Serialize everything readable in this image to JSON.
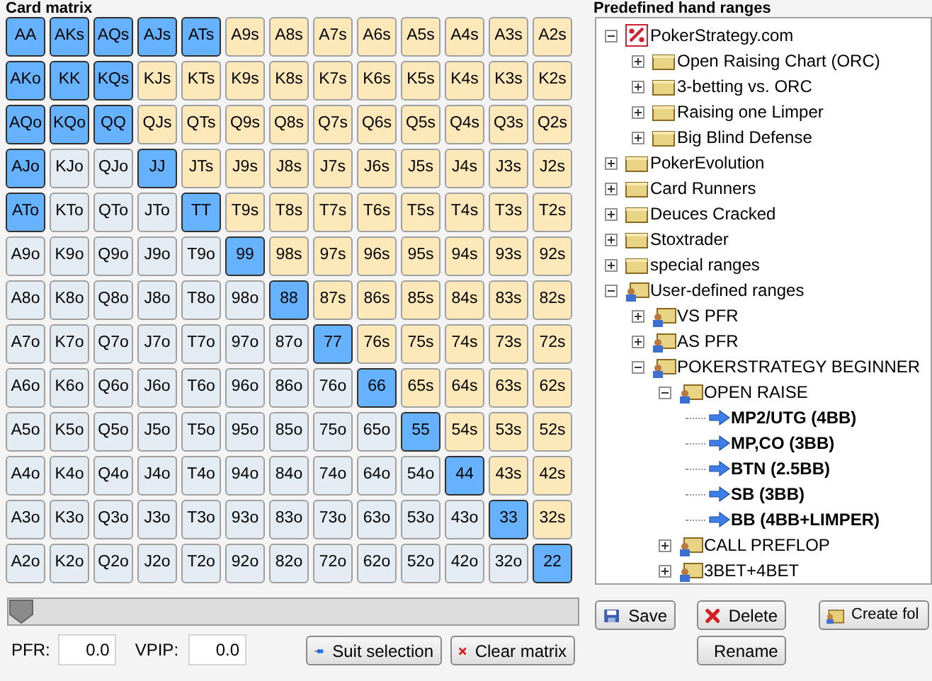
{
  "matrix": {
    "title": "Card matrix",
    "rows": [
      [
        {
          "label": "AA",
          "selected": true
        },
        {
          "label": "AKs",
          "selected": true
        },
        {
          "label": "AQs",
          "selected": true
        },
        {
          "label": "AJs",
          "selected": true
        },
        {
          "label": "ATs",
          "selected": true
        },
        {
          "label": "A9s",
          "selected": false
        },
        {
          "label": "A8s",
          "selected": false
        },
        {
          "label": "A7s",
          "selected": false
        },
        {
          "label": "A6s",
          "selected": false
        },
        {
          "label": "A5s",
          "selected": false
        },
        {
          "label": "A4s",
          "selected": false
        },
        {
          "label": "A3s",
          "selected": false
        },
        {
          "label": "A2s",
          "selected": false
        }
      ],
      [
        {
          "label": "AKo",
          "selected": true
        },
        {
          "label": "KK",
          "selected": true
        },
        {
          "label": "KQs",
          "selected": true
        },
        {
          "label": "KJs",
          "selected": false
        },
        {
          "label": "KTs",
          "selected": false
        },
        {
          "label": "K9s",
          "selected": false
        },
        {
          "label": "K8s",
          "selected": false
        },
        {
          "label": "K7s",
          "selected": false
        },
        {
          "label": "K6s",
          "selected": false
        },
        {
          "label": "K5s",
          "selected": false
        },
        {
          "label": "K4s",
          "selected": false
        },
        {
          "label": "K3s",
          "selected": false
        },
        {
          "label": "K2s",
          "selected": false
        }
      ],
      [
        {
          "label": "AQo",
          "selected": true
        },
        {
          "label": "KQo",
          "selected": true
        },
        {
          "label": "QQ",
          "selected": true
        },
        {
          "label": "QJs",
          "selected": false
        },
        {
          "label": "QTs",
          "selected": false
        },
        {
          "label": "Q9s",
          "selected": false
        },
        {
          "label": "Q8s",
          "selected": false
        },
        {
          "label": "Q7s",
          "selected": false
        },
        {
          "label": "Q6s",
          "selected": false
        },
        {
          "label": "Q5s",
          "selected": false
        },
        {
          "label": "Q4s",
          "selected": false
        },
        {
          "label": "Q3s",
          "selected": false
        },
        {
          "label": "Q2s",
          "selected": false
        }
      ],
      [
        {
          "label": "AJo",
          "selected": true
        },
        {
          "label": "KJo",
          "selected": false
        },
        {
          "label": "QJo",
          "selected": false
        },
        {
          "label": "JJ",
          "selected": true
        },
        {
          "label": "JTs",
          "selected": false
        },
        {
          "label": "J9s",
          "selected": false
        },
        {
          "label": "J8s",
          "selected": false
        },
        {
          "label": "J7s",
          "selected": false
        },
        {
          "label": "J6s",
          "selected": false
        },
        {
          "label": "J5s",
          "selected": false
        },
        {
          "label": "J4s",
          "selected": false
        },
        {
          "label": "J3s",
          "selected": false
        },
        {
          "label": "J2s",
          "selected": false
        }
      ],
      [
        {
          "label": "ATo",
          "selected": true
        },
        {
          "label": "KTo",
          "selected": false
        },
        {
          "label": "QTo",
          "selected": false
        },
        {
          "label": "JTo",
          "selected": false
        },
        {
          "label": "TT",
          "selected": true
        },
        {
          "label": "T9s",
          "selected": false
        },
        {
          "label": "T8s",
          "selected": false
        },
        {
          "label": "T7s",
          "selected": false
        },
        {
          "label": "T6s",
          "selected": false
        },
        {
          "label": "T5s",
          "selected": false
        },
        {
          "label": "T4s",
          "selected": false
        },
        {
          "label": "T3s",
          "selected": false
        },
        {
          "label": "T2s",
          "selected": false
        }
      ],
      [
        {
          "label": "A9o",
          "selected": false
        },
        {
          "label": "K9o",
          "selected": false
        },
        {
          "label": "Q9o",
          "selected": false
        },
        {
          "label": "J9o",
          "selected": false
        },
        {
          "label": "T9o",
          "selected": false
        },
        {
          "label": "99",
          "selected": true
        },
        {
          "label": "98s",
          "selected": false
        },
        {
          "label": "97s",
          "selected": false
        },
        {
          "label": "96s",
          "selected": false
        },
        {
          "label": "95s",
          "selected": false
        },
        {
          "label": "94s",
          "selected": false
        },
        {
          "label": "93s",
          "selected": false
        },
        {
          "label": "92s",
          "selected": false
        }
      ],
      [
        {
          "label": "A8o",
          "selected": false
        },
        {
          "label": "K8o",
          "selected": false
        },
        {
          "label": "Q8o",
          "selected": false
        },
        {
          "label": "J8o",
          "selected": false
        },
        {
          "label": "T8o",
          "selected": false
        },
        {
          "label": "98o",
          "selected": false
        },
        {
          "label": "88",
          "selected": true
        },
        {
          "label": "87s",
          "selected": false
        },
        {
          "label": "86s",
          "selected": false
        },
        {
          "label": "85s",
          "selected": false
        },
        {
          "label": "84s",
          "selected": false
        },
        {
          "label": "83s",
          "selected": false
        },
        {
          "label": "82s",
          "selected": false
        }
      ],
      [
        {
          "label": "A7o",
          "selected": false
        },
        {
          "label": "K7o",
          "selected": false
        },
        {
          "label": "Q7o",
          "selected": false
        },
        {
          "label": "J7o",
          "selected": false
        },
        {
          "label": "T7o",
          "selected": false
        },
        {
          "label": "97o",
          "selected": false
        },
        {
          "label": "87o",
          "selected": false
        },
        {
          "label": "77",
          "selected": true
        },
        {
          "label": "76s",
          "selected": false
        },
        {
          "label": "75s",
          "selected": false
        },
        {
          "label": "74s",
          "selected": false
        },
        {
          "label": "73s",
          "selected": false
        },
        {
          "label": "72s",
          "selected": false
        }
      ],
      [
        {
          "label": "A6o",
          "selected": false
        },
        {
          "label": "K6o",
          "selected": false
        },
        {
          "label": "Q6o",
          "selected": false
        },
        {
          "label": "J6o",
          "selected": false
        },
        {
          "label": "T6o",
          "selected": false
        },
        {
          "label": "96o",
          "selected": false
        },
        {
          "label": "86o",
          "selected": false
        },
        {
          "label": "76o",
          "selected": false
        },
        {
          "label": "66",
          "selected": true
        },
        {
          "label": "65s",
          "selected": false
        },
        {
          "label": "64s",
          "selected": false
        },
        {
          "label": "63s",
          "selected": false
        },
        {
          "label": "62s",
          "selected": false
        }
      ],
      [
        {
          "label": "A5o",
          "selected": false
        },
        {
          "label": "K5o",
          "selected": false
        },
        {
          "label": "Q5o",
          "selected": false
        },
        {
          "label": "J5o",
          "selected": false
        },
        {
          "label": "T5o",
          "selected": false
        },
        {
          "label": "95o",
          "selected": false
        },
        {
          "label": "85o",
          "selected": false
        },
        {
          "label": "75o",
          "selected": false
        },
        {
          "label": "65o",
          "selected": false
        },
        {
          "label": "55",
          "selected": true
        },
        {
          "label": "54s",
          "selected": false
        },
        {
          "label": "53s",
          "selected": false
        },
        {
          "label": "52s",
          "selected": false
        }
      ],
      [
        {
          "label": "A4o",
          "selected": false
        },
        {
          "label": "K4o",
          "selected": false
        },
        {
          "label": "Q4o",
          "selected": false
        },
        {
          "label": "J4o",
          "selected": false
        },
        {
          "label": "T4o",
          "selected": false
        },
        {
          "label": "94o",
          "selected": false
        },
        {
          "label": "84o",
          "selected": false
        },
        {
          "label": "74o",
          "selected": false
        },
        {
          "label": "64o",
          "selected": false
        },
        {
          "label": "54o",
          "selected": false
        },
        {
          "label": "44",
          "selected": true
        },
        {
          "label": "43s",
          "selected": false
        },
        {
          "label": "42s",
          "selected": false
        }
      ],
      [
        {
          "label": "A3o",
          "selected": false
        },
        {
          "label": "K3o",
          "selected": false
        },
        {
          "label": "Q3o",
          "selected": false
        },
        {
          "label": "J3o",
          "selected": false
        },
        {
          "label": "T3o",
          "selected": false
        },
        {
          "label": "93o",
          "selected": false
        },
        {
          "label": "83o",
          "selected": false
        },
        {
          "label": "73o",
          "selected": false
        },
        {
          "label": "63o",
          "selected": false
        },
        {
          "label": "53o",
          "selected": false
        },
        {
          "label": "43o",
          "selected": false
        },
        {
          "label": "33",
          "selected": true
        },
        {
          "label": "32s",
          "selected": false
        }
      ],
      [
        {
          "label": "A2o",
          "selected": false
        },
        {
          "label": "K2o",
          "selected": false
        },
        {
          "label": "Q2o",
          "selected": false
        },
        {
          "label": "J2o",
          "selected": false
        },
        {
          "label": "T2o",
          "selected": false
        },
        {
          "label": "92o",
          "selected": false
        },
        {
          "label": "82o",
          "selected": false
        },
        {
          "label": "72o",
          "selected": false
        },
        {
          "label": "62o",
          "selected": false
        },
        {
          "label": "52o",
          "selected": false
        },
        {
          "label": "42o",
          "selected": false
        },
        {
          "label": "32o",
          "selected": false
        },
        {
          "label": "22",
          "selected": true
        }
      ]
    ],
    "slider": {
      "level": 0
    },
    "pfr": {
      "label": "PFR:",
      "value": "0.0"
    },
    "vpip": {
      "label": "VPIP:",
      "value": "0.0"
    },
    "buttons": [
      {
        "kind": "suit",
        "label": "Suit selection"
      },
      {
        "kind": "clear",
        "label": "Clear matrix"
      }
    ]
  },
  "ranges": {
    "title": "Predefined hand ranges",
    "tree": [
      {
        "label": "PokerStrategy.com",
        "kind": "brand",
        "expanded": true,
        "children": [
          {
            "label": "Open Raising Chart (ORC)",
            "kind": "folder",
            "expanded": false
          },
          {
            "label": "3-betting vs. ORC",
            "kind": "folder",
            "expanded": false
          },
          {
            "label": "Raising one Limper",
            "kind": "folder",
            "expanded": false
          },
          {
            "label": "Big Blind Defense",
            "kind": "folder",
            "expanded": false
          }
        ]
      },
      {
        "label": "PokerEvolution",
        "kind": "folder",
        "expanded": false
      },
      {
        "label": "Card Runners",
        "kind": "folder",
        "expanded": false
      },
      {
        "label": "Deuces Cracked",
        "kind": "folder",
        "expanded": false
      },
      {
        "label": "Stoxtrader",
        "kind": "folder",
        "expanded": false
      },
      {
        "label": "special ranges",
        "kind": "folder",
        "expanded": false
      },
      {
        "label": "User-defined ranges",
        "kind": "user-folder",
        "expanded": true,
        "children": [
          {
            "label": "VS PFR",
            "kind": "user-folder",
            "expanded": false
          },
          {
            "label": "AS PFR",
            "kind": "user-folder",
            "expanded": false
          },
          {
            "label": "POKERSTRATEGY BEGINNER",
            "kind": "user-folder",
            "expanded": true,
            "children": [
              {
                "label": "OPEN RAISE",
                "kind": "user-folder",
                "expanded": true,
                "children": [
                  {
                    "label": "MP2/UTG (4BB)",
                    "kind": "range"
                  },
                  {
                    "label": "MP,CO (3BB)",
                    "kind": "range"
                  },
                  {
                    "label": "BTN (2.5BB)",
                    "kind": "range"
                  },
                  {
                    "label": "SB (3BB)",
                    "kind": "range"
                  },
                  {
                    "label": "BB (4BB+LIMPER)",
                    "kind": "range"
                  }
                ]
              },
              {
                "label": "CALL PREFLOP",
                "kind": "user-folder",
                "expanded": false
              },
              {
                "label": "3BET+4BET",
                "kind": "user-folder",
                "expanded": false
              }
            ]
          }
        ]
      }
    ],
    "buttons": [
      {
        "kind": "save",
        "label": "Save"
      },
      {
        "kind": "delete",
        "label": "Delete"
      },
      {
        "kind": "create",
        "label": "Create fol"
      },
      {
        "kind": "rename",
        "label": "Rename"
      }
    ]
  }
}
